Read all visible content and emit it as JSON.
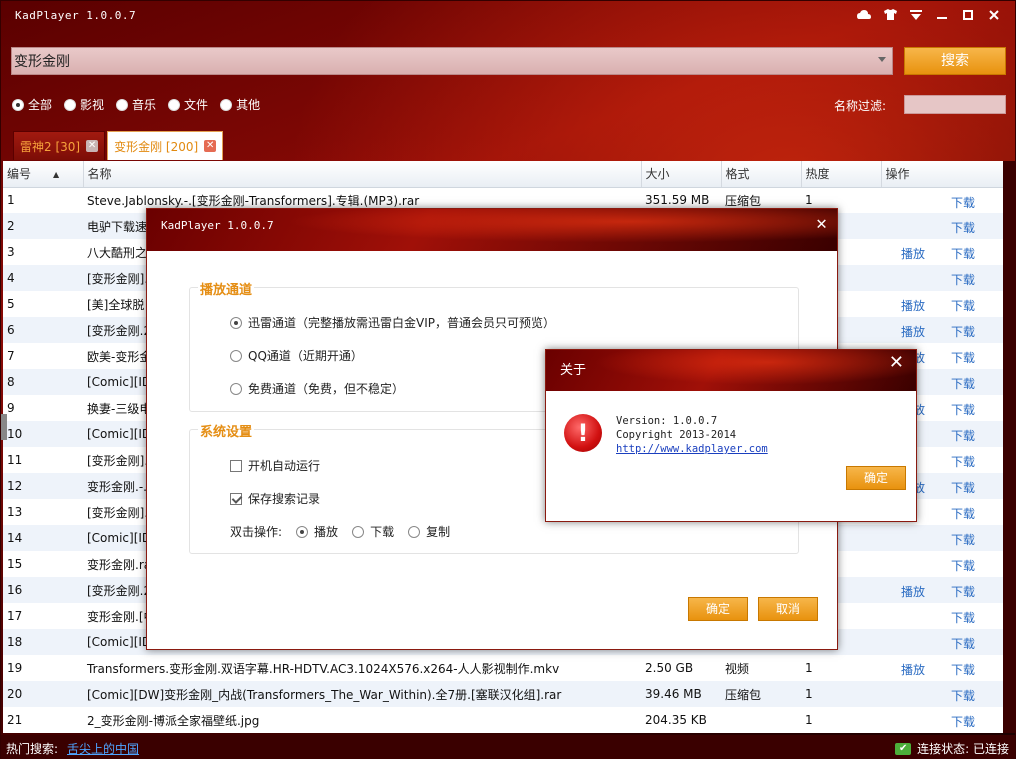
{
  "app": {
    "title": "KadPlayer 1.0.0.7",
    "window_controls": [
      "skin",
      "shirt",
      "menu",
      "minimize",
      "maximize",
      "close"
    ]
  },
  "search": {
    "query": "变形金刚",
    "button": "搜索"
  },
  "filters": {
    "options": [
      "全部",
      "影视",
      "音乐",
      "文件",
      "其他"
    ],
    "selected": "全部",
    "name_filter_label": "名称过滤:"
  },
  "tabs": [
    {
      "label": "雷神2 [30]",
      "active": false
    },
    {
      "label": "变形金刚 [200]",
      "active": true
    }
  ],
  "table": {
    "headers": [
      "编号",
      "名称",
      "大小",
      "格式",
      "热度",
      "操作"
    ],
    "rows": [
      {
        "num": "1",
        "name": "Steve.Jablonsky.-.[变形金刚-Transformers].专辑.(MP3).rar",
        "size": "351.59 MB",
        "fmt": "压缩包",
        "heat": "1",
        "play": "",
        "dl": "下载"
      },
      {
        "num": "2",
        "name": "电驴下载速度",
        "size": "",
        "fmt": "",
        "heat": "",
        "play": "",
        "dl": "下载"
      },
      {
        "num": "3",
        "name": "八大酷刑之",
        "size": "",
        "fmt": "",
        "heat": "",
        "play": "播放",
        "dl": "下载"
      },
      {
        "num": "4",
        "name": "[变形金刚].T",
        "size": "",
        "fmt": "",
        "heat": "",
        "play": "",
        "dl": "下载"
      },
      {
        "num": "5",
        "name": "[美]全球脱",
        "size": "",
        "fmt": "",
        "heat": "",
        "play": "播放",
        "dl": "下载"
      },
      {
        "num": "6",
        "name": "[变形金刚.2",
        "size": "",
        "fmt": "",
        "heat": "",
        "play": "播放",
        "dl": "下载"
      },
      {
        "num": "7",
        "name": "欧美-变形金",
        "size": "",
        "fmt": "",
        "heat": "",
        "play": "播放",
        "dl": "下载"
      },
      {
        "num": "8",
        "name": "[Comic][IDW",
        "size": "",
        "fmt": "",
        "heat": "",
        "play": "",
        "dl": "下载"
      },
      {
        "num": "9",
        "name": "换妻-三级电",
        "size": "",
        "fmt": "",
        "heat": "",
        "play": "播放",
        "dl": "下载"
      },
      {
        "num": "10",
        "name": "[Comic][IDW",
        "size": "",
        "fmt": "",
        "heat": "",
        "play": "",
        "dl": "下载"
      },
      {
        "num": "11",
        "name": "[变形金刚].T",
        "size": "",
        "fmt": "",
        "heat": "",
        "play": "",
        "dl": "下载"
      },
      {
        "num": "12",
        "name": "变形金刚.-.美",
        "size": "",
        "fmt": "",
        "heat": "",
        "play": "播放",
        "dl": "下载"
      },
      {
        "num": "13",
        "name": "[变形金刚].T",
        "size": "",
        "fmt": "",
        "heat": "",
        "play": "",
        "dl": "下载"
      },
      {
        "num": "14",
        "name": "[Comic][IDW",
        "size": "",
        "fmt": "",
        "heat": "",
        "play": "",
        "dl": "下载"
      },
      {
        "num": "15",
        "name": "变形金刚.ra",
        "size": "",
        "fmt": "",
        "heat": "",
        "play": "",
        "dl": "下载"
      },
      {
        "num": "16",
        "name": "[变形金刚.2",
        "size": "",
        "fmt": "",
        "heat": "",
        "play": "播放",
        "dl": "下载"
      },
      {
        "num": "17",
        "name": "变形金刚.[中",
        "size": "",
        "fmt": "",
        "heat": "",
        "play": "",
        "dl": "下载"
      },
      {
        "num": "18",
        "name": "[Comic][IDW",
        "size": "",
        "fmt": "",
        "heat": "",
        "play": "",
        "dl": "下载"
      },
      {
        "num": "19",
        "name": "Transformers.变形金刚.双语字幕.HR-HDTV.AC3.1024X576.x264-人人影视制作.mkv",
        "size": "2.50 GB",
        "fmt": "视频",
        "heat": "1",
        "play": "播放",
        "dl": "下载"
      },
      {
        "num": "20",
        "name": "[Comic][DW]变形金刚_内战(Transformers_The_War_Within).全7册.[塞联汉化组].rar",
        "size": "39.46 MB",
        "fmt": "压缩包",
        "heat": "1",
        "play": "",
        "dl": "下载"
      },
      {
        "num": "21",
        "name": "2_变形金刚-博派全家福壁纸.jpg",
        "size": "204.35 KB",
        "fmt": "",
        "heat": "1",
        "play": "",
        "dl": "下载"
      }
    ]
  },
  "status": {
    "hot_label": "热门搜索:",
    "hot_link": "舌尖上的中国",
    "connection": "连接状态: 已连接"
  },
  "settings_dialog": {
    "title": "KadPlayer 1.0.0.7",
    "play_channel": {
      "title": "播放通道",
      "options": [
        "迅雷通道（完整播放需迅雷白金VIP，普通会员只可预览）",
        "QQ通道（近期开通）",
        "免费通道（免费，但不稳定）"
      ],
      "selected": 0
    },
    "system": {
      "title": "系统设置",
      "autostart": "开机自动运行",
      "autostart_checked": false,
      "save_history": "保存搜索记录",
      "save_history_checked": true,
      "dblclick_label": "双击操作:",
      "dblclick_options": [
        "播放",
        "下载",
        "复制"
      ],
      "dblclick_selected": 0
    },
    "ok": "确定",
    "cancel": "取消"
  },
  "about_dialog": {
    "title": "关于",
    "version": "Version: 1.0.0.7",
    "copyright": "Copyright 2013-2014",
    "url": "http://www.kadplayer.com",
    "ok": "确定"
  },
  "colors": {
    "accent": "#e8920e",
    "link": "#2a6bc2",
    "tab_text": "#e28a10",
    "group_title": "#e58e14"
  }
}
